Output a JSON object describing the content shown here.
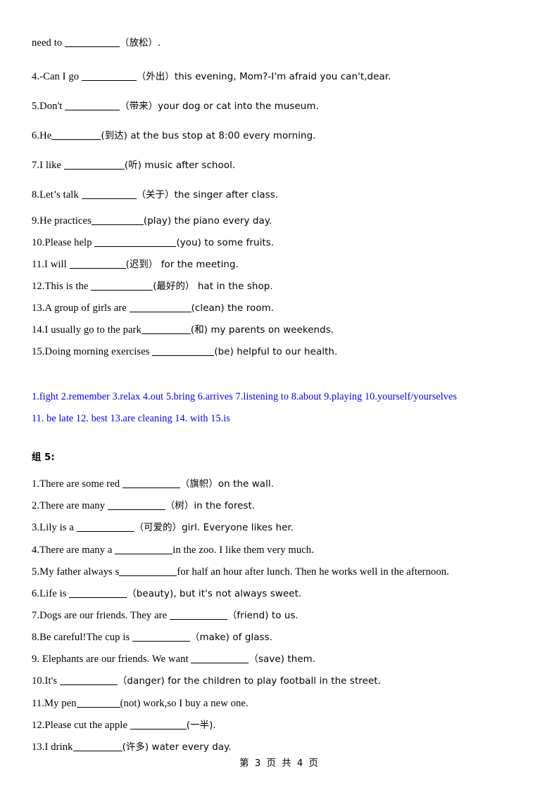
{
  "document": {
    "page_footer": "第 3 页 共 4 页",
    "answer_color": "#0000ff",
    "text_color": "#000000",
    "background": "#ffffff"
  },
  "section_group4_tail": {
    "exercises": [
      {
        "before": "need to ",
        "blank_width": 78,
        "after": "（放松）."
      },
      {
        "before": "4.-Can I go ",
        "blank_width": 78,
        "after": "（外出）this evening, Mom?-I'm afraid you can't,dear."
      },
      {
        "before": "5.Don't ",
        "blank_width": 78,
        "after": "（带来）your dog or cat into the museum."
      },
      {
        "before": "6.He",
        "blank_width": 70,
        "after": "(到达) at the bus stop at 8:00 every morning."
      },
      {
        "before": "7.I like ",
        "blank_width": 86,
        "after": "(听) music after school."
      },
      {
        "before": "8.Let’s talk ",
        "blank_width": 78,
        "after": "（关于）the singer after class."
      },
      {
        "before": "9.He practices",
        "blank_width": 74,
        "after": "(play) the piano every day."
      },
      {
        "before": "10.Please help ",
        "blank_width": 116,
        "after": "(you) to some fruits."
      },
      {
        "before": "11.I will ",
        "blank_width": 80,
        "after": "(迟到）  for the meeting."
      },
      {
        "before": "12.This is the ",
        "blank_width": 88,
        "after": "(最好的）  hat in the shop."
      },
      {
        "before": "13.A group of girls are ",
        "blank_width": 88,
        "after": "(clean) the room."
      },
      {
        "before": "14.I usually go to the park",
        "blank_width": 70,
        "after": "(和) my parents on weekends."
      },
      {
        "before": "15.Doing morning exercises ",
        "blank_width": 88,
        "after": "(be) helpful to our health."
      }
    ],
    "answer_key": {
      "line1": "1.fight 2.remember 3.relax 4.out   5.bring 6.arrives 7.listening to 8.about 9.playing 10.yourself/yourselves",
      "line2": "11. be late 12. best 13.are cleaning   14. with   15.is"
    }
  },
  "section_group5": {
    "heading": "组 5:",
    "exercises": [
      {
        "before": "1.There are some red ",
        "blank_width": 82,
        "after": "（旗帜）on the wall."
      },
      {
        "before": "2.There are many ",
        "blank_width": 82,
        "after": "（树）in the forest."
      },
      {
        "before": "3.Lily is a ",
        "blank_width": 82,
        "after": "（可爱的）girl. Everyone likes her."
      },
      {
        "before": "4.There are many a ",
        "blank_width": 82,
        "after": "in the zoo. I like them very much."
      },
      {
        "before": "5.My father always s",
        "blank_width": 82,
        "after": "for half an hour after lunch. Then he works well in the afternoon."
      },
      {
        "before": "6.Life is ",
        "blank_width": 82,
        "after": "（beauty), but it's not always sweet."
      },
      {
        "before": "7.Dogs are our friends. They are ",
        "blank_width": 82,
        "after": "（friend) to us."
      },
      {
        "before": "8.Be careful!The cup is ",
        "blank_width": 82,
        "after": "（make) of glass."
      },
      {
        "before": "9. Elephants are our friends. We want ",
        "blank_width": 82,
        "after": "（save) them."
      },
      {
        "before": "10.It's ",
        "blank_width": 82,
        "after": "（danger) for the children to play football in the street."
      },
      {
        "before": "11.My pen",
        "blank_width": 62,
        "after": "(not) work,so I buy a new one."
      },
      {
        "before": "12.Please cut the apple ",
        "blank_width": 80,
        "after": "(一半)."
      },
      {
        "before": "13.I drink",
        "blank_width": 70,
        "after": "(许多) water every day."
      }
    ]
  }
}
